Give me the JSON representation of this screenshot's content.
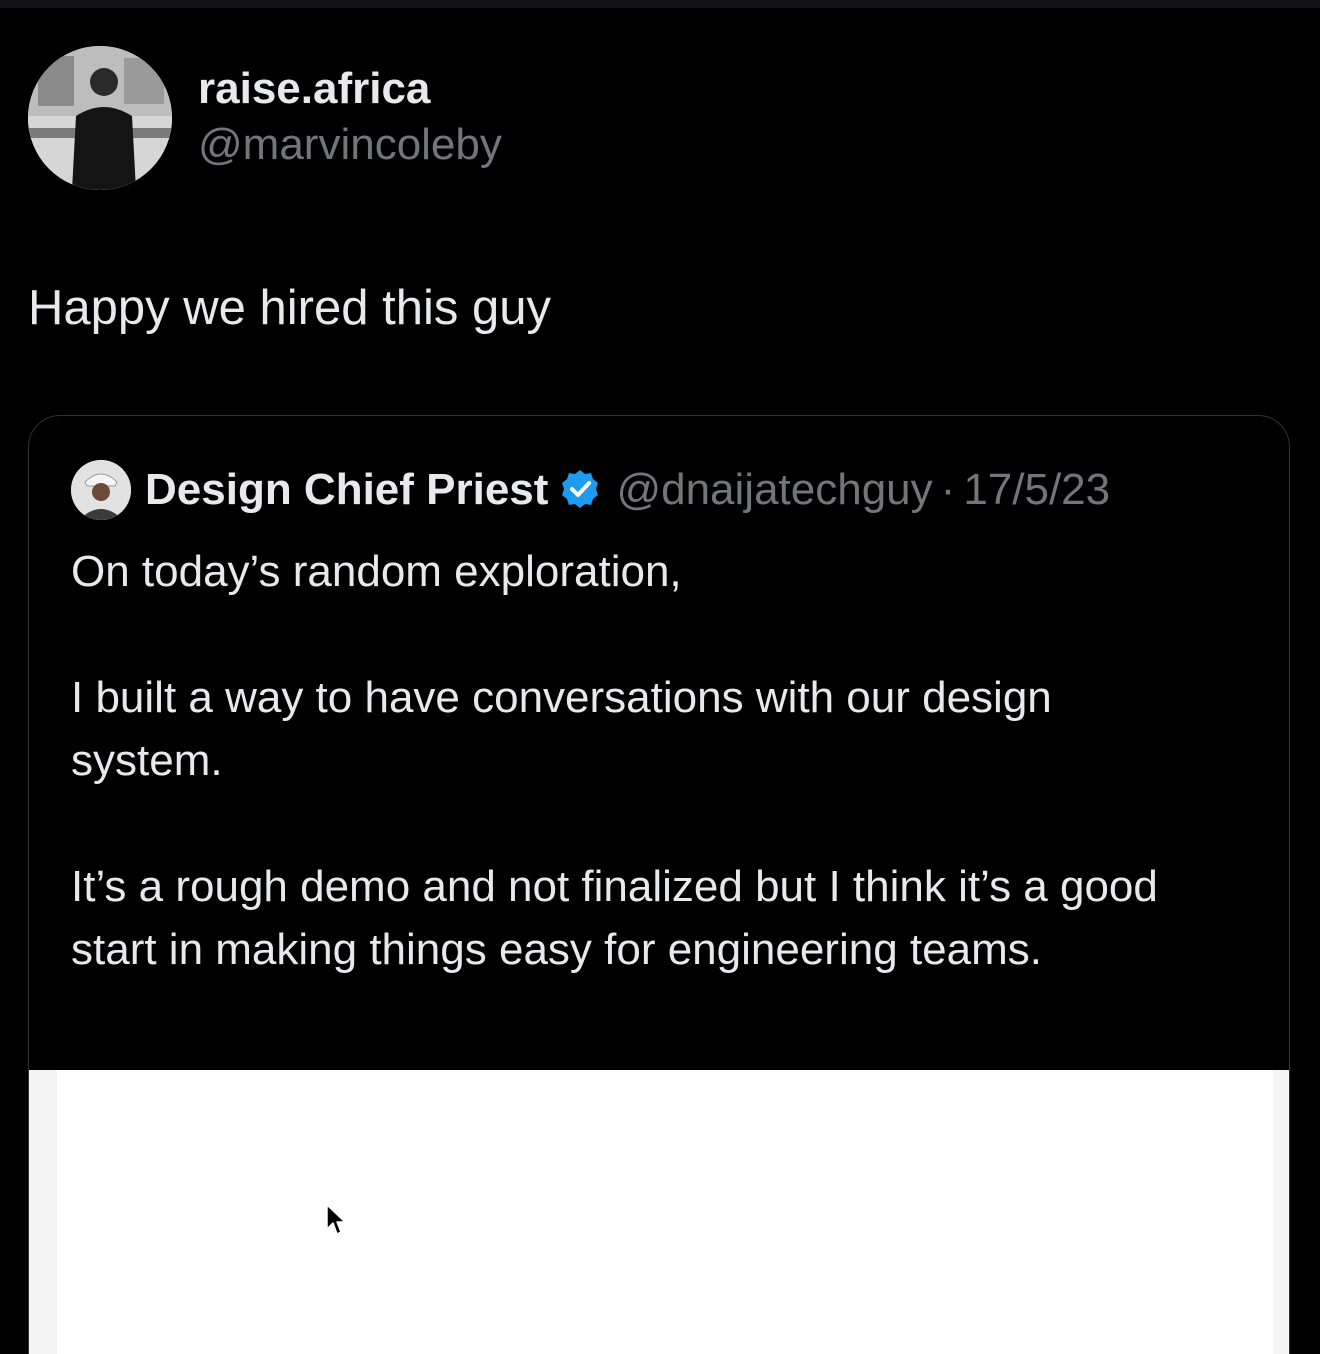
{
  "tweet": {
    "author": {
      "display_name": "raise.africa",
      "handle": "@marvincoleby"
    },
    "text": "Happy we hired this guy"
  },
  "quoted_tweet": {
    "author": {
      "display_name": "Design Chief Priest",
      "handle": "@dnaijatechguy",
      "verified": true
    },
    "separator": "·",
    "date": "17/5/23",
    "paragraphs": [
      "On today’s random exploration,",
      "I built a way to have conversations with our design system.",
      "It’s a rough demo and not finalized but I think it’s a good start in making things easy for engineering teams."
    ]
  },
  "colors": {
    "background": "#000000",
    "primary_text": "#e7e9ea",
    "secondary_text": "#71767b",
    "border": "#2f3336",
    "verified_badge": "#1d9bf0"
  },
  "icons": {
    "verified": "verified-badge-icon",
    "cursor": "mouse-pointer-icon"
  }
}
